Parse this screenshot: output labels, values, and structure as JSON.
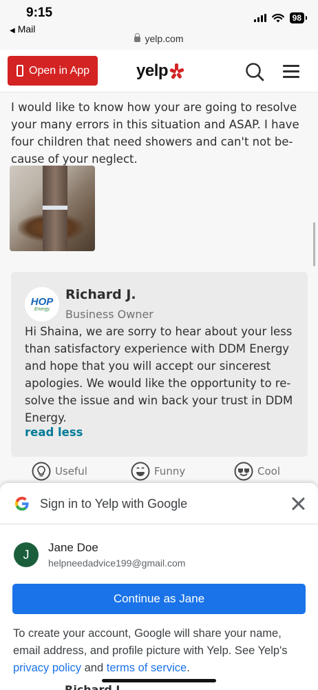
{
  "status_bar": {
    "time": "9:15",
    "back_label": "Mail",
    "url": "yelp.com",
    "battery": "98"
  },
  "header": {
    "open_app_label": "Open in App",
    "logo_text": "yelp",
    "brand_color": "#d32323"
  },
  "review": {
    "text": "I would like to know how your are going to resolve your many errors in this situation and ASAP. I have four children that need showers and can't not be-cause of your neglect.",
    "owner_reply": {
      "logo_text": "HOP",
      "logo_subtext": "Energy",
      "name": "Richard J.",
      "role": "Business Owner",
      "text": "Hi Shaina, we are sorry to hear about your less than satisfactory experience with DDM Energy and hope that you will accept our sincerest apologies. We would like the opportunity to re-solve the issue and win back your trust in DDM Energy.",
      "toggle_label": "read less"
    },
    "reactions": [
      {
        "label": "Useful",
        "icon": "lightbulb-icon"
      },
      {
        "label": "Funny",
        "icon": "smile-icon"
      },
      {
        "label": "Cool",
        "icon": "sunglasses-icon"
      }
    ]
  },
  "google_signin": {
    "title": "Sign in to Yelp with Google",
    "account_initial": "J",
    "account_name": "Jane Doe",
    "account_email": "helpneedadvice199@gmail.com",
    "continue_label": "Continue as Jane",
    "disclaimer_before": "To create your account, Google will share your name, email address, and profile picture with Yelp. See Yelp's ",
    "privacy_link": "privacy policy",
    "disclaimer_and": " and ",
    "terms_link": "terms of service",
    "disclaimer_end": ".",
    "peek_text": "Richard J.",
    "button_color": "#1a73e8",
    "avatar_color": "#1b5e3b"
  }
}
